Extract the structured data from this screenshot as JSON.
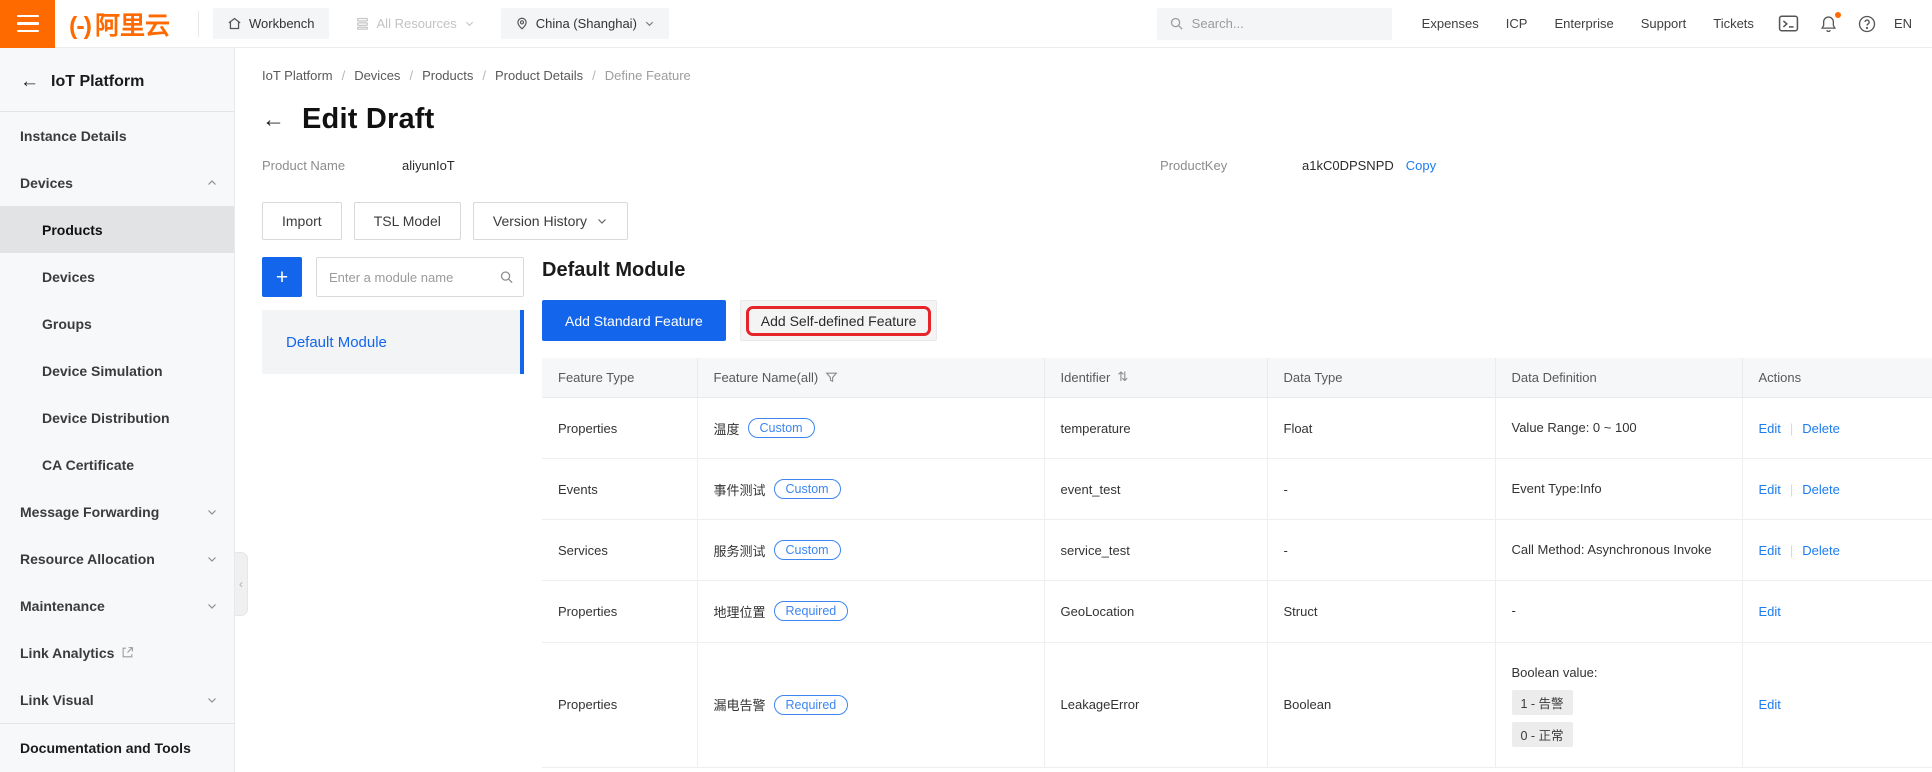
{
  "colors": {
    "brand_orange": "#FF6A00",
    "accent_blue": "#1366EC",
    "link_blue": "#1C7CF0",
    "badge_blue": "#3D86F2",
    "annotation_red": "#E6252B"
  },
  "topbar": {
    "logo_bracket": "(-)",
    "logo_text": "阿里云",
    "workbench": "Workbench",
    "all_resources": "All Resources",
    "region": "China (Shanghai)",
    "search_placeholder": "Search...",
    "links": [
      "Expenses",
      "ICP",
      "Enterprise",
      "Support",
      "Tickets"
    ],
    "icons": [
      "console-icon",
      "bell-icon",
      "help-icon"
    ],
    "lang": "EN"
  },
  "sidebar": {
    "title": "IoT Platform",
    "items": [
      {
        "label": "Instance Details",
        "indent": 0
      },
      {
        "label": "Devices",
        "indent": 0,
        "chevron": "up"
      },
      {
        "label": "Products",
        "indent": 1,
        "active": true
      },
      {
        "label": "Devices",
        "indent": 1
      },
      {
        "label": "Groups",
        "indent": 1
      },
      {
        "label": "Device Simulation",
        "indent": 1
      },
      {
        "label": "Device Distribution",
        "indent": 1
      },
      {
        "label": "CA Certificate",
        "indent": 1
      },
      {
        "label": "Message Forwarding",
        "indent": 0,
        "chevron": "down"
      },
      {
        "label": "Resource Allocation",
        "indent": 0,
        "chevron": "down"
      },
      {
        "label": "Maintenance",
        "indent": 0,
        "chevron": "down"
      },
      {
        "label": "Link Analytics",
        "indent": 0,
        "external": true
      },
      {
        "label": "Link Visual",
        "indent": 0,
        "chevron": "down"
      },
      {
        "label": "Documentation and Tools",
        "indent": 0,
        "section": true,
        "divider_before": true
      }
    ]
  },
  "breadcrumb": [
    "IoT Platform",
    "Devices",
    "Products",
    "Product Details",
    "Define Feature"
  ],
  "page": {
    "title": "Edit Draft",
    "product_name_label": "Product Name",
    "product_name": "aliyunIoT",
    "product_key_label": "ProductKey",
    "product_key": "a1kC0DPSNPD",
    "copy_label": "Copy"
  },
  "toolbar": {
    "import_label": "Import",
    "tsl_label": "TSL Model",
    "version_label": "Version History"
  },
  "modules": {
    "search_placeholder": "Enter a module name",
    "selected": "Default Module"
  },
  "main": {
    "heading": "Default Module",
    "add_standard_label": "Add Standard Feature",
    "add_custom_label": "Add Self-defined Feature"
  },
  "table": {
    "columns": [
      {
        "label": "Feature Type"
      },
      {
        "label": "Feature Name(all)",
        "icon": "funnel-icon"
      },
      {
        "label": "Identifier",
        "icon": "sort-icon"
      },
      {
        "label": "Data Type"
      },
      {
        "label": "Data Definition"
      },
      {
        "label": "Actions"
      }
    ],
    "rows": [
      {
        "feature_type": "Properties",
        "name": "温度",
        "name_badge": "Custom",
        "identifier": "temperature",
        "data_type": "Float",
        "data_definition": {
          "text": "Value Range: 0 ~ 100"
        },
        "actions": [
          "Edit",
          "Delete"
        ]
      },
      {
        "feature_type": "Events",
        "name": "事件测试",
        "name_badge": "Custom",
        "identifier": "event_test",
        "data_type": "-",
        "data_definition": {
          "text": "Event Type:Info"
        },
        "actions": [
          "Edit",
          "Delete"
        ]
      },
      {
        "feature_type": "Services",
        "name": "服务测试",
        "name_badge": "Custom",
        "identifier": "service_test",
        "data_type": "-",
        "data_definition": {
          "text": "Call Method: Asynchronous Invoke"
        },
        "actions": [
          "Edit",
          "Delete"
        ]
      },
      {
        "feature_type": "Properties",
        "name": "地理位置",
        "name_badge": "Required",
        "identifier": "GeoLocation",
        "data_type": "Struct",
        "data_definition": {
          "text": "-"
        },
        "actions": [
          "Edit"
        ]
      },
      {
        "feature_type": "Properties",
        "name": "漏电告警",
        "name_badge": "Required",
        "identifier": "LeakageError",
        "data_type": "Boolean",
        "data_definition": {
          "text": "Boolean value:",
          "chips": [
            "1 - 告警",
            "0 - 正常"
          ]
        },
        "actions": [
          "Edit"
        ]
      }
    ]
  }
}
